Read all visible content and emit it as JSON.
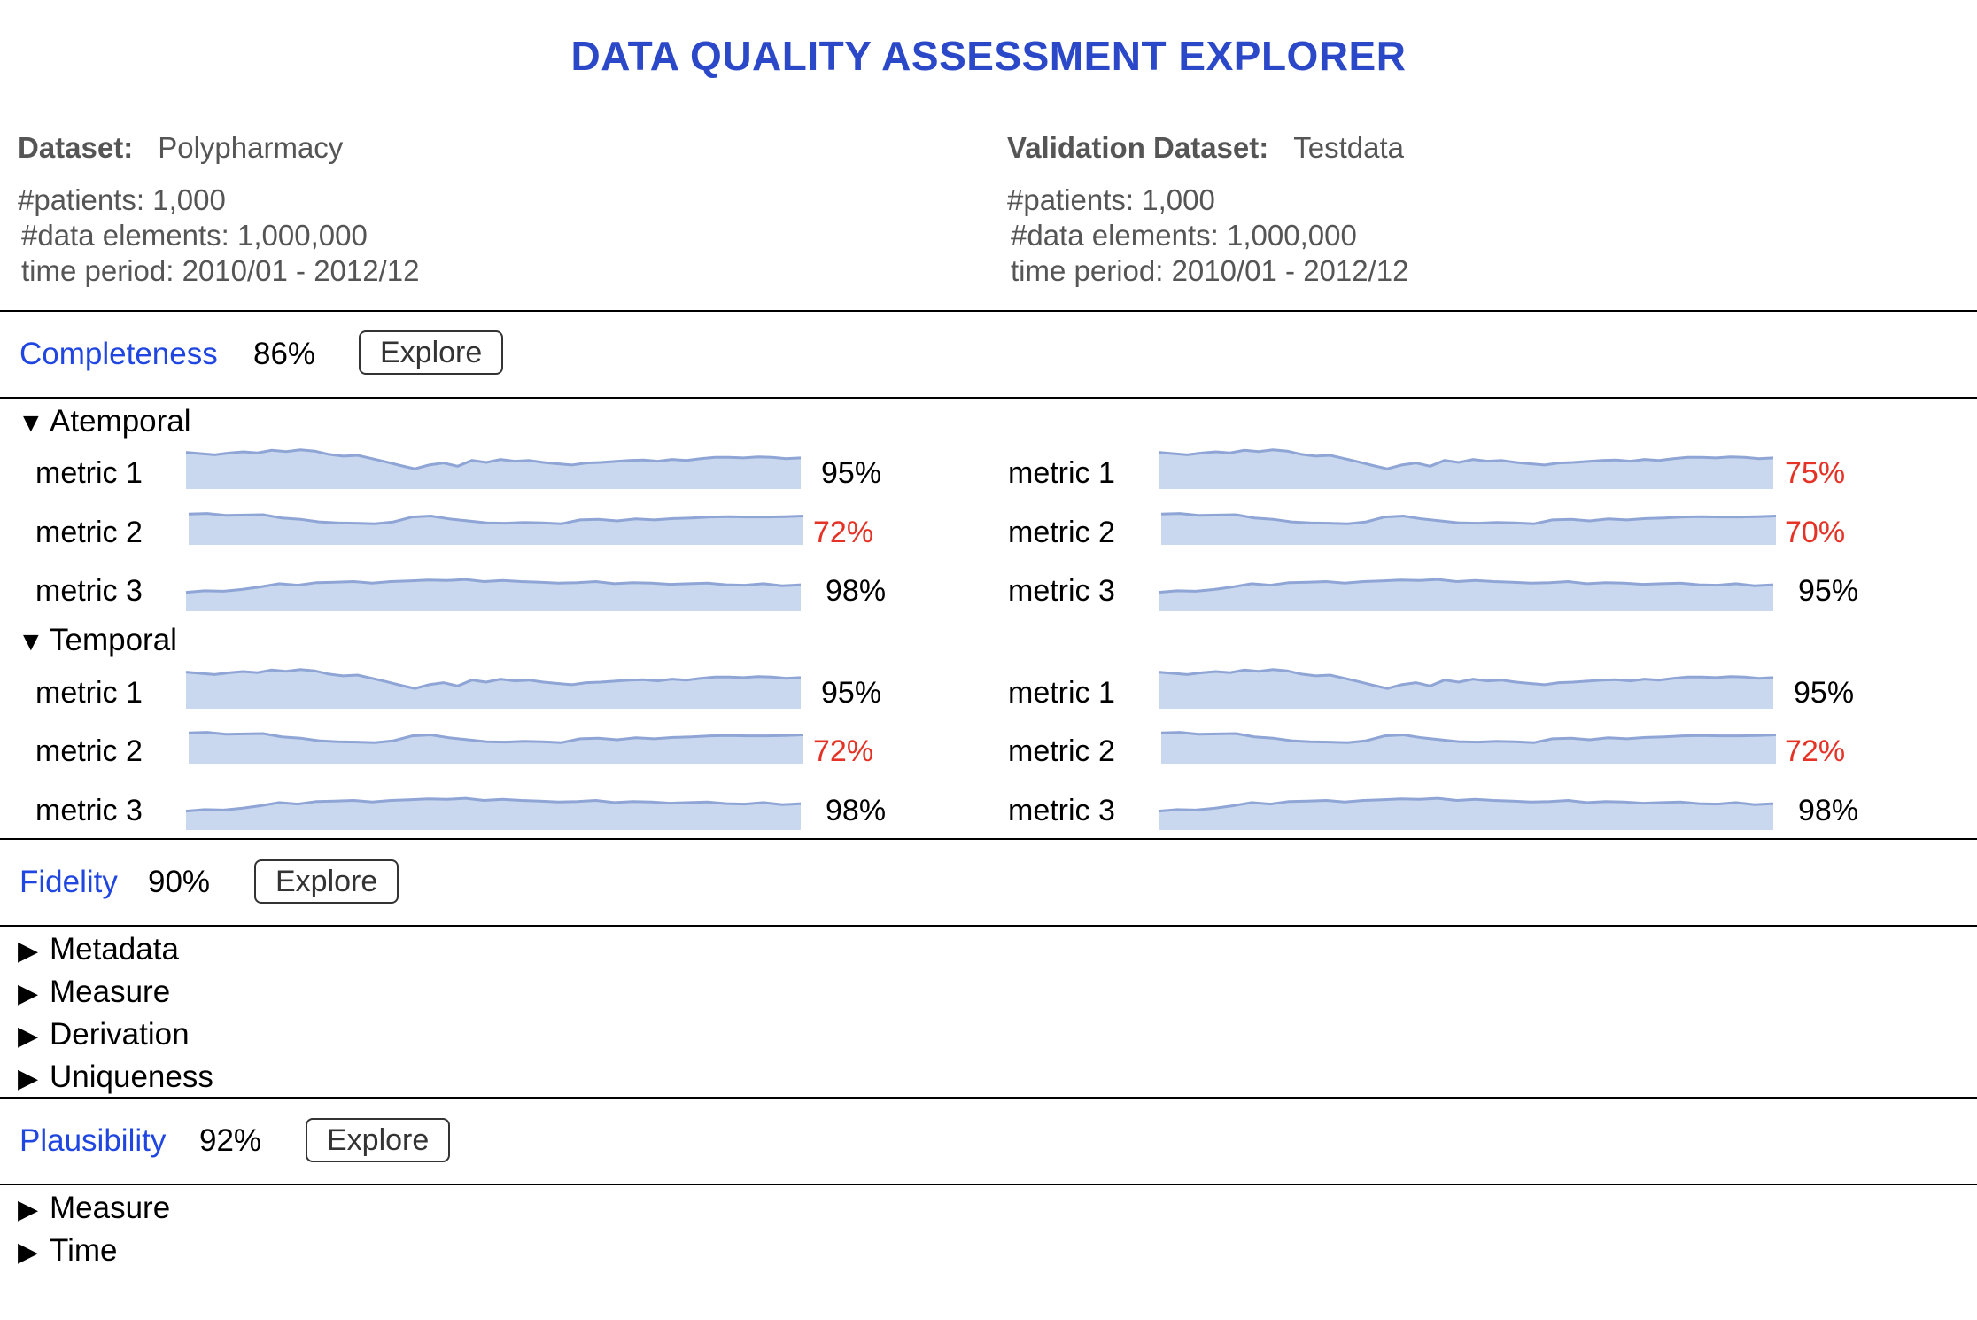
{
  "title": "DATA QUALITY ASSESSMENT EXPLORER",
  "dataset": {
    "label": "Dataset:",
    "name": "Polypharmacy",
    "patients": "#patients: 1,000",
    "elements": "#data elements: 1,000,000",
    "period": "time period: 2010/01 - 2012/12"
  },
  "validation": {
    "label": "Validation Dataset:",
    "name": "Testdata",
    "patients": "#patients: 1,000",
    "elements": "#data elements: 1,000,000",
    "period": "time period: 2010/01 - 2012/12"
  },
  "colors": {
    "accent": "#2a48c8",
    "dimension_link": "#1f46e0",
    "alert": "#e53226",
    "sparkline_fill": "#c9d8ee",
    "sparkline_line": "#8fa5d6"
  },
  "dimensions": {
    "completeness": {
      "name": "Completeness",
      "score": "86%",
      "explore": "Explore",
      "groups": [
        {
          "name": "Atemporal",
          "expanded": true,
          "metrics": [
            {
              "label": "metric 1",
              "left": "95%",
              "right": "75%",
              "left_low": false,
              "right_low": true,
              "shape": "a"
            },
            {
              "label": "metric 2",
              "left": "72%",
              "right": "70%",
              "left_low": true,
              "right_low": true,
              "shape": "b"
            },
            {
              "label": "metric 3",
              "left": "98%",
              "right": "95%",
              "left_low": false,
              "right_low": false,
              "shape": "c"
            }
          ]
        },
        {
          "name": "Temporal",
          "expanded": true,
          "metrics": [
            {
              "label": "metric 1",
              "left": "95%",
              "right": "95%",
              "left_low": false,
              "right_low": false,
              "shape": "a"
            },
            {
              "label": "metric 2",
              "left": "72%",
              "right": "72%",
              "left_low": true,
              "right_low": true,
              "shape": "b"
            },
            {
              "label": "metric 3",
              "left": "98%",
              "right": "98%",
              "left_low": false,
              "right_low": false,
              "shape": "c"
            }
          ]
        }
      ]
    },
    "fidelity": {
      "name": "Fidelity",
      "score": "90%",
      "explore": "Explore",
      "groups": [
        "Metadata",
        "Measure",
        "Derivation",
        "Uniqueness"
      ]
    },
    "plausibility": {
      "name": "Plausibility",
      "score": "92%",
      "explore": "Explore",
      "groups": [
        "Measure",
        "Time"
      ]
    }
  },
  "icons": {
    "expanded": "▼",
    "collapsed": "▶"
  }
}
